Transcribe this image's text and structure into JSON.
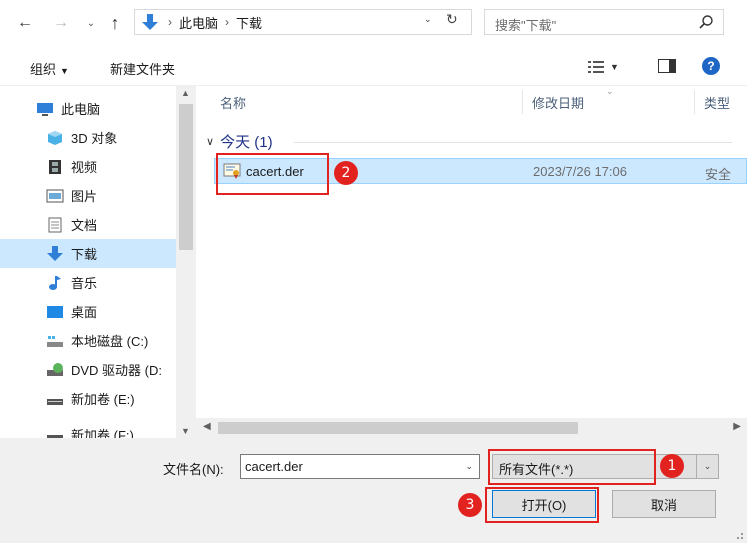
{
  "address_bar": {
    "breadcrumbs": [
      "此电脑",
      "下载"
    ],
    "separator": "›",
    "search_placeholder": "搜索\"下载\""
  },
  "toolbar": {
    "organize_label": "组织",
    "new_folder_label": "新建文件夹"
  },
  "nav": {
    "items": [
      {
        "label": "此电脑",
        "icon": "monitor-icon"
      },
      {
        "label": "3D 对象",
        "icon": "cube-icon"
      },
      {
        "label": "视频",
        "icon": "film-icon"
      },
      {
        "label": "图片",
        "icon": "picture-icon"
      },
      {
        "label": "文档",
        "icon": "document-icon"
      },
      {
        "label": "下载",
        "icon": "download-arrow-icon"
      },
      {
        "label": "音乐",
        "icon": "music-note-icon"
      },
      {
        "label": "桌面",
        "icon": "desktop-icon"
      },
      {
        "label": "本地磁盘 (C:)",
        "icon": "drive-icon"
      },
      {
        "label": "DVD 驱动器 (D:",
        "icon": "dvd-drive-icon"
      },
      {
        "label": "新加卷 (E:)",
        "icon": "volume-icon"
      },
      {
        "label": "新加卷 (F:)",
        "icon": "volume-icon"
      }
    ],
    "selected_index": 5
  },
  "file_list": {
    "columns": {
      "name": "名称",
      "date": "修改日期",
      "type": "类型"
    },
    "group_label": "今天 (1)",
    "files": [
      {
        "name": "cacert.der",
        "date": "2023/7/26 17:06",
        "type": "安全"
      }
    ]
  },
  "bottom": {
    "filename_label": "文件名(N):",
    "filename_value": "cacert.der",
    "filetype_value": "所有文件(*.*)",
    "open_label": "打开(O)",
    "cancel_label": "取消"
  },
  "annotations": {
    "step1": "1",
    "step2": "2",
    "step3": "3"
  },
  "colors": {
    "highlight": "#e2221f",
    "selection": "#cce8ff",
    "accent": "#1e66c5"
  }
}
